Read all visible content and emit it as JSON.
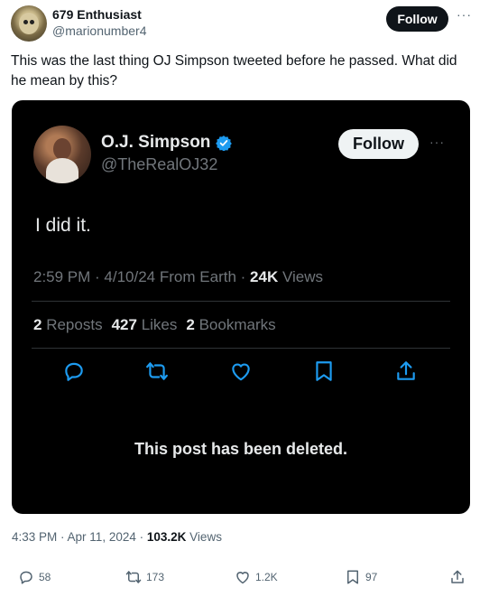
{
  "outer": {
    "display_name": "679 Enthusiast",
    "handle": "@marionumber4",
    "follow_label": "Follow",
    "more_label": "···",
    "text": "This was the last thing OJ Simpson tweeted before he passed. What did he mean by this?",
    "time": "4:33 PM",
    "date": "Apr 11, 2024",
    "views_count": "103.2K",
    "views_label": "Views",
    "actions": {
      "replies": "58",
      "reposts": "173",
      "likes": "1.2K",
      "bookmarks": "97"
    }
  },
  "embed": {
    "display_name": "O.J. Simpson",
    "handle": "@TheRealOJ32",
    "follow_label": "Follow",
    "more_label": "···",
    "text": "I did it.",
    "time": "2:59 PM",
    "date": "4/10/24",
    "source": "From Earth",
    "views_count": "24K",
    "views_label": "Views",
    "reposts_count": "2",
    "reposts_label": "Reposts",
    "likes_count": "427",
    "likes_label": "Likes",
    "bookmarks_count": "2",
    "bookmarks_label": "Bookmarks",
    "deleted_notice": "This post has been deleted."
  },
  "colors": {
    "verified_badge": "#1d9bf0",
    "embed_background": "#000000",
    "accent_dark": "#0f1419"
  },
  "icons": [
    "reply-icon",
    "repost-icon",
    "like-icon",
    "bookmark-icon",
    "share-icon",
    "verified-badge-icon",
    "more-icon"
  ]
}
